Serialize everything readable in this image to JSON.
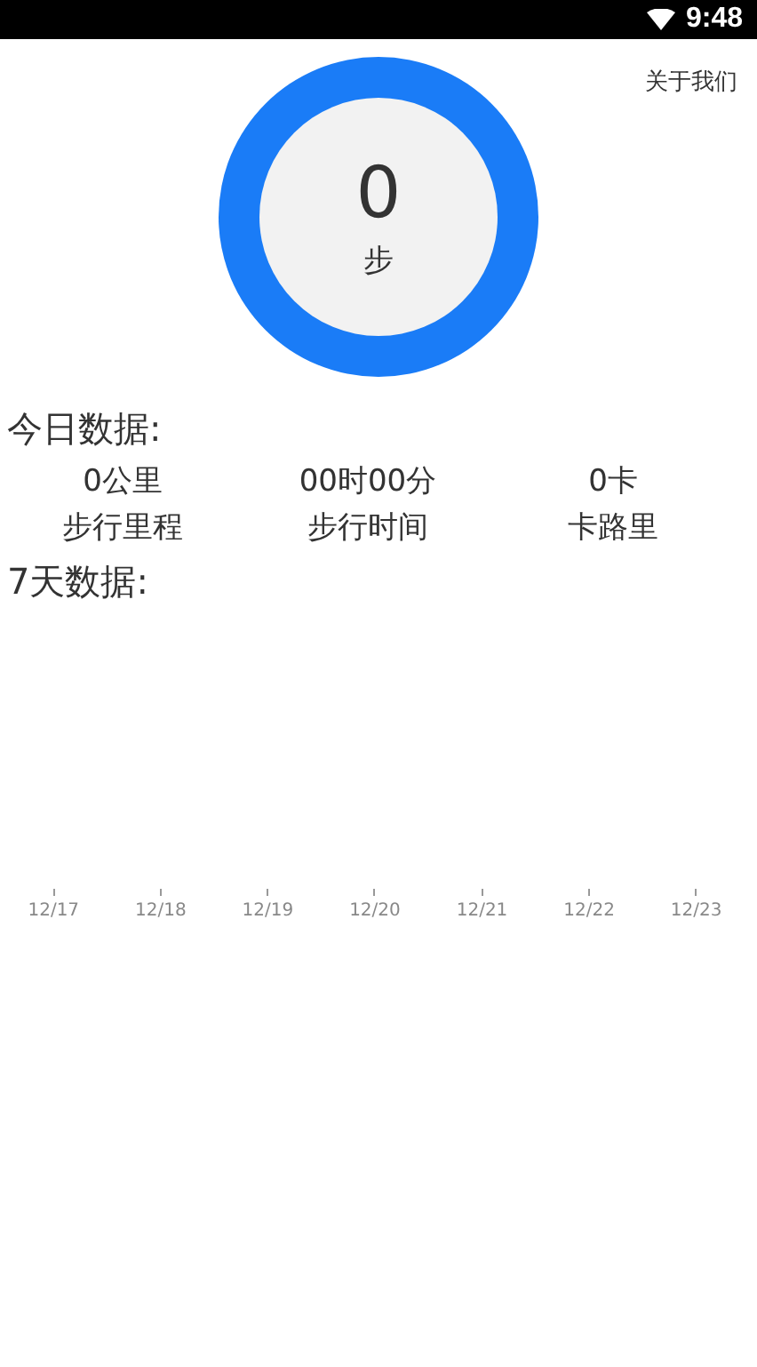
{
  "status_bar": {
    "time": "9:48"
  },
  "about_link": "关于我们",
  "steps": {
    "value": "0",
    "unit": "步"
  },
  "today": {
    "title": "今日数据:",
    "stats": [
      {
        "value": "0公里",
        "label": "步行里程"
      },
      {
        "value": "00时00分",
        "label": "步行时间"
      },
      {
        "value": "0卡",
        "label": "卡路里"
      }
    ]
  },
  "week": {
    "title": "7天数据:",
    "x_labels": [
      "12/17",
      "12/18",
      "12/19",
      "12/20",
      "12/21",
      "12/22",
      "12/23"
    ]
  }
}
